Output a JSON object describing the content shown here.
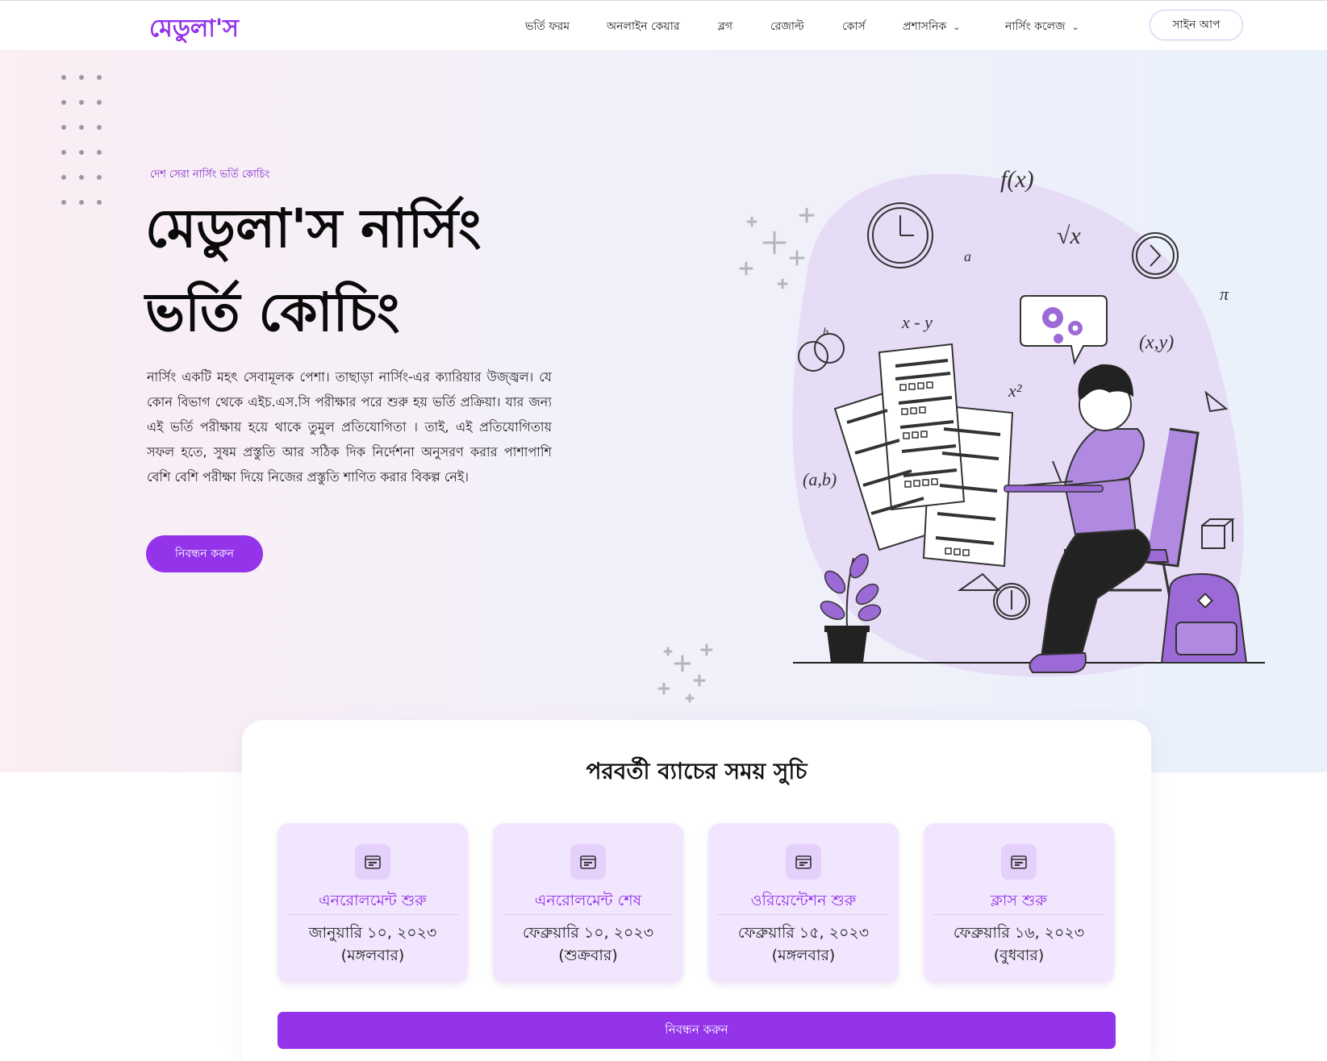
{
  "brand": {
    "logo": "মেডুলা'স",
    "accent": "#9333ea"
  },
  "nav": {
    "items": [
      {
        "label": "ভর্তি ফরম",
        "dropdown": false
      },
      {
        "label": "অনলাইন কেয়ার",
        "dropdown": false
      },
      {
        "label": "ব্লগ",
        "dropdown": false
      },
      {
        "label": "রেজাল্ট",
        "dropdown": false
      },
      {
        "label": "কোর্স",
        "dropdown": false
      },
      {
        "label": "প্রশাসনিক",
        "dropdown": true
      },
      {
        "label": "নার্সিং কলেজ",
        "dropdown": true
      }
    ],
    "signup": "সাইন আপ"
  },
  "hero": {
    "tagline": "দেশ সেরা নার্সিং ভর্তি কোচিং",
    "title_line1": "মেডুলা'স নার্সিং",
    "title_line2": "ভর্তি কোচিং",
    "description": "নার্সিং একটি মহৎ সেবামূলক পেশা। তাছাড়া নার্সিং-এর ক্যারিয়ার উজ্জ্বল। যে কোন বিভাগ থেকে এইচ.এস.সি পরীক্ষার পরে শুরু হয় ভর্তি প্রক্রিয়া। যার জন্য এই ভর্তি পরীক্ষায় হয়ে থাকে তুমুল প্রতিযোগিতা । তাই, এই প্রতিযোগিতায় সফল হতে, সুষম প্রস্তুতি আর সঠিক দিক নির্দেশনা অনুসরণ করার পাশাপাশি বেশি বেশি পরীক্ষা দিয়ে নিজের প্রস্তুতি শাণিত করার বিকল্প নেই।",
    "cta": "নিবন্ধন করুন",
    "illustration": {
      "math_labels": [
        "f(x)",
        "√x",
        "a",
        "b",
        "x - y",
        "x²",
        "(x,y)",
        "(a,b)",
        "π"
      ]
    }
  },
  "schedule": {
    "title": "পরবর্তী ব্যাচের সময় সুচি",
    "cards": [
      {
        "label": "এনরোলমেন্ট শুরু",
        "date": "জানুয়ারি ১০, ২০২৩",
        "day": "(মঙ্গলবার)",
        "icon": "calendar-icon"
      },
      {
        "label": "এনরোলমেন্ট শেষ",
        "date": "ফেব্রুয়ারি ১০, ২০২৩",
        "day": "(শুক্রবার)",
        "icon": "calendar-icon"
      },
      {
        "label": "ওরিয়েন্টেশন শুরু",
        "date": "ফেব্রুয়ারি ১৫, ২০২৩",
        "day": "(মঙ্গলবার)",
        "icon": "calendar-icon"
      },
      {
        "label": "ক্লাস শুরু",
        "date": "ফেব্রুয়ারি ১৬, ২০২৩",
        "day": "(বুধবার)",
        "icon": "calendar-icon"
      }
    ],
    "cta": "নিবন্ধন করুন"
  }
}
